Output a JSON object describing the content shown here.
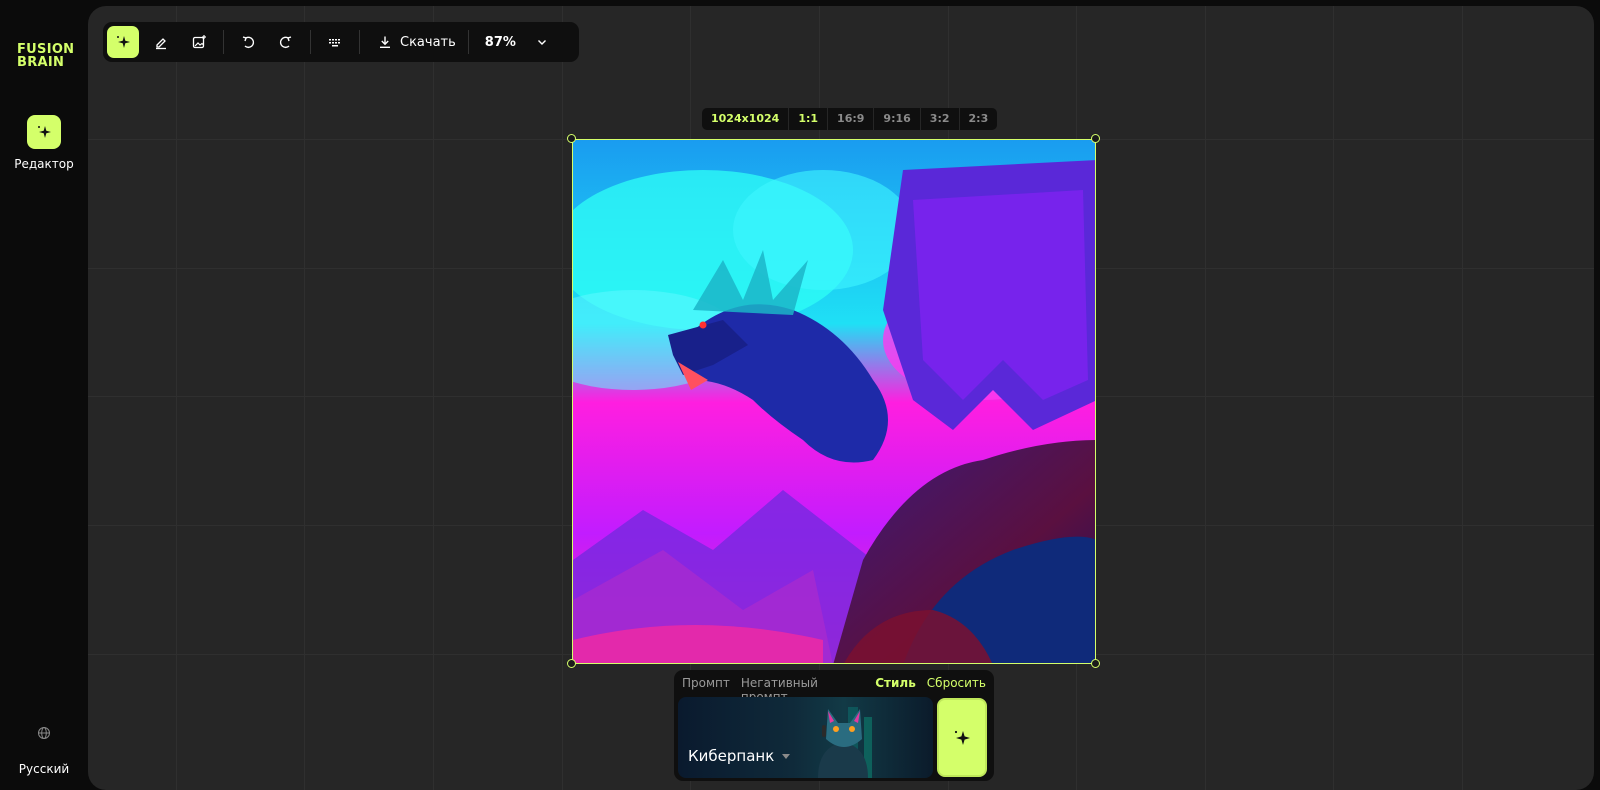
{
  "app": {
    "logo_line1": "FUSION",
    "logo_line2": "BRAIN"
  },
  "sidebar": {
    "editor_label": "Редактор",
    "language_label": "Русский"
  },
  "toolbar": {
    "download_label": "Скачать",
    "zoom": "87%"
  },
  "aspect": {
    "size": "1024x1024",
    "ratios": [
      "1:1",
      "16:9",
      "9:16",
      "3:2",
      "2:3"
    ],
    "selected": "1:1"
  },
  "panel": {
    "tabs": [
      "Промпт",
      "Негативный промпт",
      "Стиль"
    ],
    "selected_tab": "Стиль",
    "reset_label": "Сбросить",
    "style_name": "Киберпанк"
  },
  "colors": {
    "accent": "#d4ff6a",
    "canvas": "#262626",
    "background": "#0b0b0b"
  }
}
